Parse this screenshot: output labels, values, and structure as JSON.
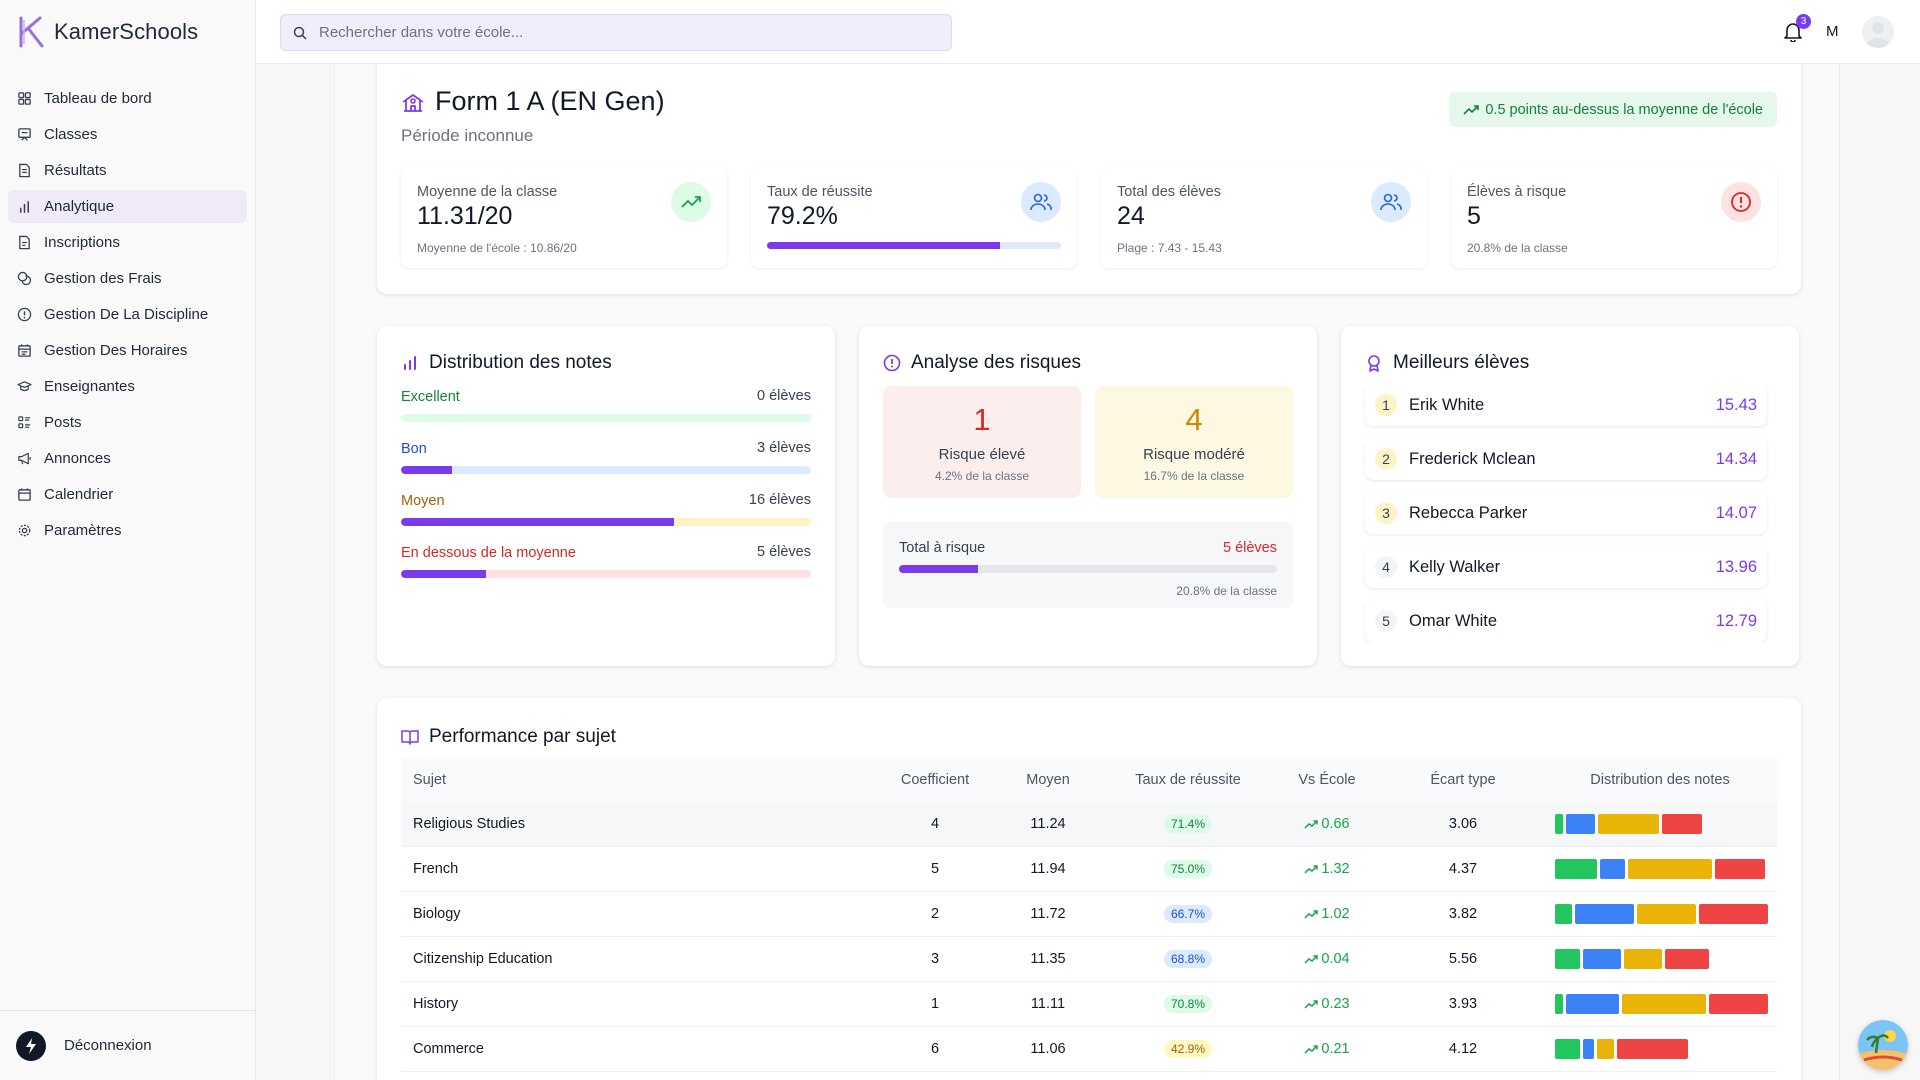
{
  "app": {
    "name": "KamerSchools"
  },
  "search": {
    "placeholder": "Rechercher dans votre école..."
  },
  "topbar": {
    "notification_count": "3",
    "user_initial": "M"
  },
  "sidebar": {
    "items": [
      {
        "label": "Tableau de bord",
        "icon": "grid-icon"
      },
      {
        "label": "Classes",
        "icon": "presentation-icon"
      },
      {
        "label": "Résultats",
        "icon": "file-text-icon"
      },
      {
        "label": "Analytique",
        "icon": "bar-chart-icon"
      },
      {
        "label": "Inscriptions",
        "icon": "file-icon"
      },
      {
        "label": "Gestion des Frais",
        "icon": "coins-icon"
      },
      {
        "label": "Gestion De La Discipline",
        "icon": "alert-circle-icon"
      },
      {
        "label": "Gestion Des Horaires",
        "icon": "calendar-clock-icon"
      },
      {
        "label": "Enseignantes",
        "icon": "graduation-cap-icon"
      },
      {
        "label": "Posts",
        "icon": "layout-list-icon"
      },
      {
        "label": "Annonces",
        "icon": "megaphone-icon"
      },
      {
        "label": "Calendrier",
        "icon": "calendar-icon"
      },
      {
        "label": "Paramètres",
        "icon": "settings-icon"
      }
    ],
    "active_index": 3,
    "logout_label": "Déconnexion"
  },
  "header": {
    "class_name": "Form 1 A (EN Gen)",
    "period": "Période inconnue",
    "comparison": "0.5 points au-dessus la moyenne de l'école"
  },
  "stats": {
    "average": {
      "label": "Moyenne de la classe",
      "value": "11.31/20",
      "sub": "Moyenne de l'école : 10.86/20"
    },
    "pass_rate": {
      "label": "Taux de réussite",
      "value": "79.2%",
      "fill_percent": 79.2
    },
    "total": {
      "label": "Total des élèves",
      "value": "24",
      "sub": "Plage : 7.43 - 15.43"
    },
    "at_risk": {
      "label": "Élèves à risque",
      "value": "5",
      "sub": "20.8% de la classe"
    }
  },
  "distribution": {
    "title": "Distribution des notes",
    "rows": [
      {
        "label": "Excellent",
        "count": "0 élèves",
        "percent": 0,
        "color": "#15803d",
        "track": "#dcfce7"
      },
      {
        "label": "Bon",
        "count": "3 élèves",
        "percent": 12.5,
        "color": "#1d4ed8",
        "track": "#dbeafe"
      },
      {
        "label": "Moyen",
        "count": "16 élèves",
        "percent": 66.7,
        "color": "#a16207",
        "track": "#fef3c7"
      },
      {
        "label": "En dessous de la moyenne",
        "count": "5 élèves",
        "percent": 20.8,
        "color": "#dc2626",
        "track": "#fee2e2"
      }
    ]
  },
  "risk": {
    "title": "Analyse des risques",
    "high": {
      "count": "1",
      "label": "Risque élevé",
      "percent": "4.2% de la classe"
    },
    "moderate": {
      "count": "4",
      "label": "Risque modéré",
      "percent": "16.7% de la classe"
    },
    "total": {
      "label": "Total à risque",
      "value": "5 élèves",
      "percent_text": "20.8% de la classe",
      "fill_percent": 20.8
    }
  },
  "top_students": {
    "title": "Meilleurs élèves",
    "items": [
      {
        "rank": "1",
        "name": "Erik White",
        "score": "15.43",
        "rank_bg": "#fef3c7"
      },
      {
        "rank": "2",
        "name": "Frederick Mclean",
        "score": "14.34",
        "rank_bg": "#fef3c7"
      },
      {
        "rank": "3",
        "name": "Rebecca Parker",
        "score": "14.07",
        "rank_bg": "#fef3c7"
      },
      {
        "rank": "4",
        "name": "Kelly Walker",
        "score": "13.96",
        "rank_bg": "#f3f4f6"
      },
      {
        "rank": "5",
        "name": "Omar White",
        "score": "12.79",
        "rank_bg": "#f3f4f6"
      }
    ]
  },
  "performance": {
    "title": "Performance par sujet",
    "columns": [
      "Sujet",
      "Coefficient",
      "Moyen",
      "Taux de réussite",
      "Vs École",
      "Écart type",
      "Distribution des notes"
    ],
    "rows": [
      {
        "subject": "Religious Studies",
        "coef": "4",
        "avg": "11.24",
        "rate": "71.4%",
        "rate_tone": "green",
        "vs": "0.66",
        "std": "3.06",
        "dist": [
          4,
          14,
          29,
          19
        ]
      },
      {
        "subject": "French",
        "coef": "5",
        "avg": "11.94",
        "rate": "75.0%",
        "rate_tone": "green",
        "vs": "1.32",
        "std": "4.37",
        "dist": [
          20,
          12,
          40,
          24
        ]
      },
      {
        "subject": "Biology",
        "coef": "2",
        "avg": "11.72",
        "rate": "66.7%",
        "rate_tone": "blue",
        "vs": "1.02",
        "std": "3.82",
        "dist": [
          8,
          28,
          28,
          33
        ]
      },
      {
        "subject": "Citizenship Education",
        "coef": "3",
        "avg": "11.35",
        "rate": "68.8%",
        "rate_tone": "blue",
        "vs": "0.04",
        "std": "5.56",
        "dist": [
          12,
          18,
          18,
          21
        ]
      },
      {
        "subject": "History",
        "coef": "1",
        "avg": "11.11",
        "rate": "70.8%",
        "rate_tone": "green",
        "vs": "0.23",
        "std": "3.93",
        "dist": [
          4,
          25,
          40,
          28
        ]
      },
      {
        "subject": "Commerce",
        "coef": "6",
        "avg": "11.06",
        "rate": "42.9%",
        "rate_tone": "yellow",
        "vs": "0.21",
        "std": "4.12",
        "dist": [
          12,
          5,
          8,
          34
        ]
      }
    ]
  },
  "colors": {
    "accent": "#7c3aed",
    "green": "#22c55e",
    "blue": "#3b82f6",
    "yellow": "#eab308",
    "red": "#ef4444"
  }
}
